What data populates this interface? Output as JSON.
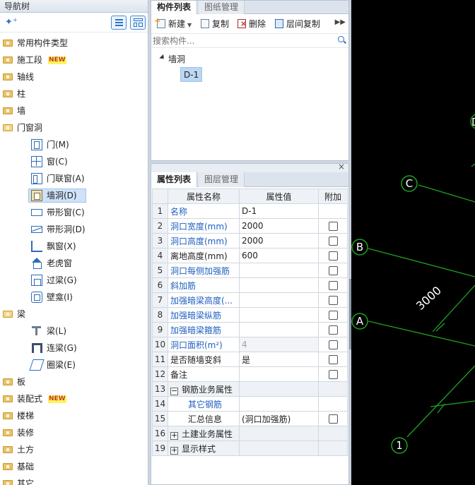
{
  "nav": {
    "title": "导航树",
    "new_badge": "NEW",
    "items": [
      {
        "label": "常用构件类型",
        "open": false
      },
      {
        "label": "施工段",
        "badge": true,
        "open": false
      },
      {
        "label": "轴线",
        "open": false
      },
      {
        "label": "柱",
        "open": false
      },
      {
        "label": "墙",
        "open": false
      },
      {
        "label": "门窗洞",
        "open": true
      },
      {
        "label": "梁",
        "open": true
      },
      {
        "label": "板",
        "open": false
      },
      {
        "label": "装配式",
        "badge": true,
        "open": false
      },
      {
        "label": "楼梯",
        "open": false
      },
      {
        "label": "装修",
        "open": false
      },
      {
        "label": "土方",
        "open": false
      },
      {
        "label": "基础",
        "open": false
      },
      {
        "label": "其它",
        "open": false
      }
    ],
    "openings": [
      {
        "label": "门(M)",
        "icon": "door-icon"
      },
      {
        "label": "窗(C)",
        "icon": "window-icon"
      },
      {
        "label": "门联窗(A)",
        "icon": "door-window-icon"
      },
      {
        "label": "墙洞(D)",
        "icon": "wall-hole-icon",
        "selected": true
      },
      {
        "label": "带形窗(C)",
        "icon": "strip-window-icon"
      },
      {
        "label": "带形洞(D)",
        "icon": "strip-hole-icon"
      },
      {
        "label": "飘窗(X)",
        "icon": "bay-window-icon"
      },
      {
        "label": "老虎窗",
        "icon": "dormer-icon"
      },
      {
        "label": "过梁(G)",
        "icon": "lintel-icon"
      },
      {
        "label": "壁龛(I)",
        "icon": "niche-icon"
      }
    ],
    "beams": [
      {
        "label": "梁(L)",
        "icon": "beam-icon"
      },
      {
        "label": "连梁(G)",
        "icon": "link-beam-icon"
      },
      {
        "label": "圈梁(E)",
        "icon": "ring-beam-icon"
      }
    ]
  },
  "component_panel": {
    "tabs": [
      "构件列表",
      "图纸管理"
    ],
    "toolbar": {
      "new": "新建",
      "copy": "复制",
      "delete": "删除",
      "floor_copy": "层间复制"
    },
    "search_placeholder": "搜索构件...",
    "tree": {
      "group": "墙洞",
      "item": "D-1"
    }
  },
  "property_panel": {
    "tabs": [
      "属性列表",
      "图层管理"
    ],
    "headers": [
      "属性名称",
      "属性值",
      "附加"
    ],
    "rows": [
      {
        "n": "1",
        "name": "名称",
        "value": "D-1",
        "blue": true,
        "check": false
      },
      {
        "n": "2",
        "name": "洞口宽度(mm)",
        "value": "2000",
        "blue": true,
        "check": true
      },
      {
        "n": "3",
        "name": "洞口高度(mm)",
        "value": "2000",
        "blue": true,
        "check": true
      },
      {
        "n": "4",
        "name": "离地高度(mm)",
        "value": "600",
        "blue": false,
        "check": true
      },
      {
        "n": "5",
        "name": "洞口每侧加强筋",
        "value": "",
        "blue": true,
        "check": true
      },
      {
        "n": "6",
        "name": "斜加筋",
        "value": "",
        "blue": true,
        "check": true
      },
      {
        "n": "7",
        "name": "加强暗梁高度(...",
        "value": "",
        "blue": true,
        "check": true
      },
      {
        "n": "8",
        "name": "加强暗梁纵筋",
        "value": "",
        "blue": true,
        "check": true
      },
      {
        "n": "9",
        "name": "加强暗梁箍筋",
        "value": "",
        "blue": true,
        "check": true
      },
      {
        "n": "10",
        "name": "洞口面积(m²)",
        "value": "4",
        "blue": true,
        "check": true,
        "gray": true
      },
      {
        "n": "11",
        "name": "是否随墙变斜",
        "value": "是",
        "blue": false,
        "check": true
      },
      {
        "n": "12",
        "name": "备注",
        "value": "",
        "blue": false,
        "check": true
      },
      {
        "n": "13",
        "name": "钢筋业务属性",
        "value": "",
        "group": true,
        "expand": "−"
      },
      {
        "n": "14",
        "name": "其它钢筋",
        "value": "",
        "blue": true,
        "indent": 2,
        "check": false
      },
      {
        "n": "15",
        "name": "汇总信息",
        "value": "(洞口加强筋)",
        "blue": false,
        "indent": 2,
        "check": true
      },
      {
        "n": "16",
        "name": "土建业务属性",
        "value": "",
        "group": true,
        "expand": "+"
      },
      {
        "n": "19",
        "name": "显示样式",
        "value": "",
        "group": true,
        "expand": "+"
      }
    ]
  },
  "canvas": {
    "axes": [
      "C",
      "B",
      "A",
      "1"
    ],
    "dimension": "3000",
    "partial_label": "D",
    "line_color": "#1fa11f",
    "text_color": "#ffffff"
  }
}
